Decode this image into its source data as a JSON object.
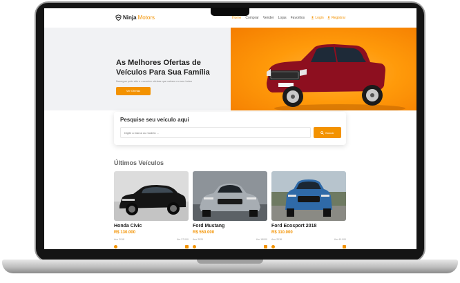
{
  "nav": {
    "logo_part1": "Ninja",
    "logo_part2": "Motors",
    "menu": [
      "Home",
      "Comprar",
      "Vender",
      "Lojas",
      "Favoritos"
    ],
    "login": "Login",
    "register": "Registrar"
  },
  "hero": {
    "title_line1": "As Melhores Ofertas de",
    "title_line2": "Veículos Para Sua Família",
    "subtitle": "Navegue pelo site e encontre ofertas que cabem no seu bolso",
    "cta": "Ver Ofertas"
  },
  "search": {
    "title": "Pesquise seu veículo aqui",
    "placeholder": "Digite a marca ou modelo ...",
    "button": "Buscar"
  },
  "latest": {
    "title": "Últimos Veículos",
    "cars": [
      {
        "name": "Honda Civic",
        "price": "R$ 130.000",
        "year": "Ano 2018",
        "km": "Km 37.000"
      },
      {
        "name": "Ford Mustang",
        "price": "R$ 550.000",
        "year": "Ano 2020",
        "km": "Km 18000"
      },
      {
        "name": "Ford Ecosport 2018",
        "price": "R$ 110.000",
        "year": "Ano 2018",
        "km": "Km 40.000"
      }
    ]
  },
  "colors": {
    "accent": "#f39200",
    "hero_orange": "#ff9a0a"
  }
}
